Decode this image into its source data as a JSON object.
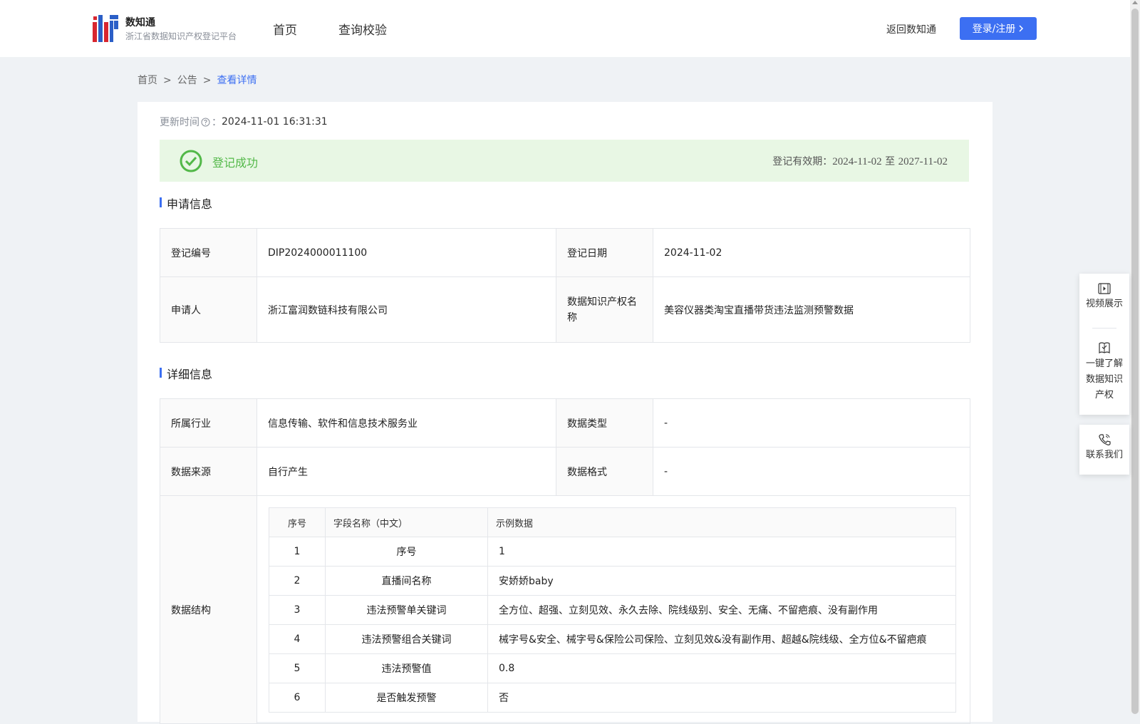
{
  "header": {
    "brand_name": "数知通",
    "brand_sub": "浙江省数据知识产权登记平台",
    "nav": [
      "首页",
      "查询校验"
    ],
    "back_link": "返回数知通",
    "login_button": "登录/注册"
  },
  "breadcrumb": [
    "首页",
    "公告",
    "查看详情"
  ],
  "update": {
    "label": "更新时间",
    "colon": "：",
    "value": "2024-11-01 16:31:31"
  },
  "status": {
    "text": "登记成功",
    "validity_label": "登记有效期：",
    "start": "2024-11-02",
    "to": "至",
    "end": "2027-11-02"
  },
  "sections": {
    "apply_info": "申请信息",
    "detail_info": "详细信息"
  },
  "apply": {
    "reg_no_label": "登记编号",
    "reg_no": "DIP2024000011100",
    "reg_date_label": "登记日期",
    "reg_date": "2024-11-02",
    "applicant_label": "申请人",
    "applicant": "浙江富润数链科技有限公司",
    "ip_name_label": "数据知识产权名称",
    "ip_name": "美容仪器类淘宝直播带货违法监测预警数据"
  },
  "detail": {
    "industry_label": "所属行业",
    "industry": "信息传输、软件和信息技术服务业",
    "data_type_label": "数据类型",
    "data_type": "-",
    "source_label": "数据来源",
    "source": "自行产生",
    "format_label": "数据格式",
    "format": "-",
    "structure_label": "数据结构"
  },
  "structure_table": {
    "headers": [
      "序号",
      "字段名称（中文）",
      "示例数据"
    ],
    "rows": [
      [
        "1",
        "序号",
        "1"
      ],
      [
        "2",
        "直播间名称",
        "安娇娇baby"
      ],
      [
        "3",
        "违法预警单关键词",
        "全方位、超强、立刻见效、永久去除、院线级别、安全、无痛、不留疤痕、没有副作用"
      ],
      [
        "4",
        "违法预警组合关键词",
        "械字号&安全、械字号&保险公司保险、立刻见效&没有副作用、超越&院线级、全方位&不留疤痕"
      ],
      [
        "5",
        "违法预警值",
        "0.8"
      ],
      [
        "6",
        "是否触发预警",
        "否"
      ]
    ]
  },
  "float_panel": {
    "video": "视频展示",
    "learn_lines": [
      "一键了解",
      "数据知识",
      "产权"
    ],
    "contact": "联系我们"
  },
  "colors": {
    "primary": "#3c6ff2",
    "success": "#52b848",
    "success_bg": "#e8f7e4"
  }
}
